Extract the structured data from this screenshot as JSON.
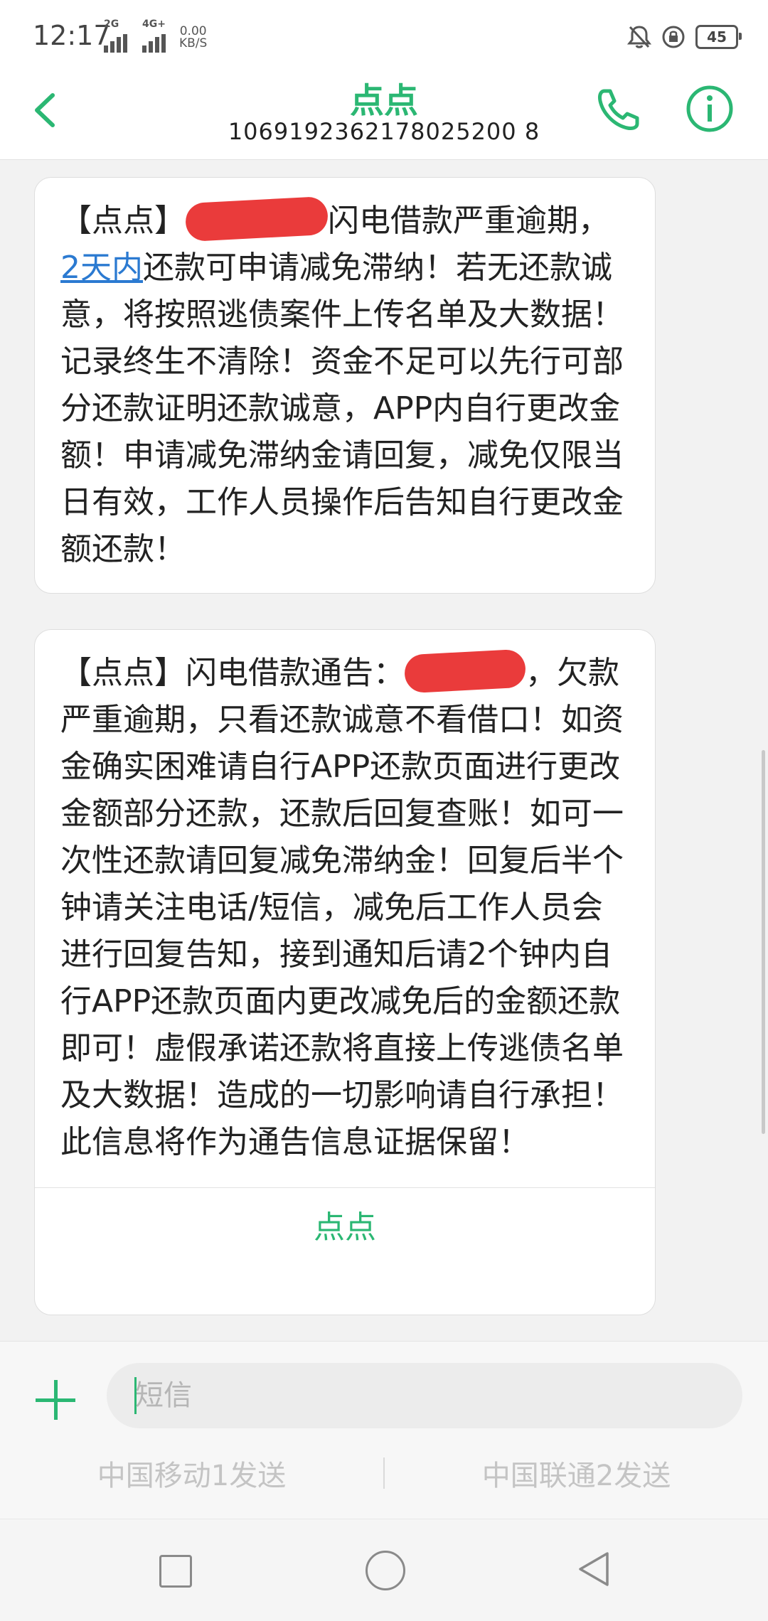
{
  "status_bar": {
    "time": "12:17",
    "net1": "2G",
    "net2": "4G+",
    "speed_value": "0.00",
    "speed_unit": "KB/S",
    "battery": "45"
  },
  "header": {
    "title": "点点",
    "number": "1069192362178025200 8"
  },
  "messages": [
    {
      "prefix": "【点点】",
      "link": "2天内",
      "after_redact": "闪电借款严重逾期，",
      "body": "还款可申请减免滞纳！若无还款诚意，将按照逃债案件上传名单及大数据！记录终生不清除！资金不足可以先行可部分还款证明还款诚意，APP内自行更改金额！申请减免滞纳金请回复，减免仅限当日有效，工作人员操作后告知自行更改金额还款！"
    },
    {
      "prefix": "【点点】闪电借款通告：",
      "after_redact": "，欠款",
      "body": "严重逾期，只看还款诚意不看借口！如资金确实困难请自行APP还款页面进行更改金额部分还款，还款后回复查账！如可一次性还款请回复减免滞纳金！回复后半个钟请关注电话/短信，减免后工作人员会进行回复告知，接到通知后请2个钟内自行APP还款页面内更改减免后的金额还款即可！虚假承诺还款将直接上传逃债名单及大数据！造成的一切影响请自行承担！此信息将作为通告信息证据保留！",
      "sender_button": "点点"
    }
  ],
  "composer": {
    "placeholder": "短信",
    "send1": "中国移动1发送",
    "send2": "中国联通2发送"
  },
  "colors": {
    "accent": "#2bb773",
    "link": "#2b7ad1",
    "redaction": "#ea3b3b"
  },
  "icons": [
    "back-arrow-icon",
    "phone-icon",
    "info-icon",
    "plus-icon",
    "nav-recent-icon",
    "nav-home-icon",
    "nav-back-icon"
  ]
}
